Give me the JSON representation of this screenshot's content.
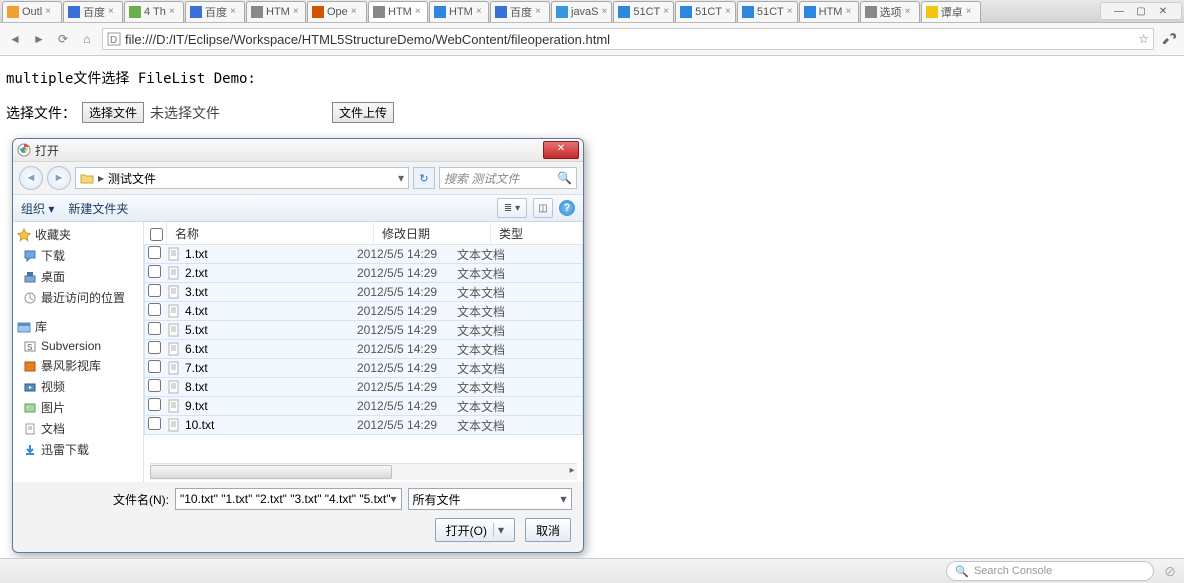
{
  "tabs": [
    {
      "label": "Outl"
    },
    {
      "label": "百度"
    },
    {
      "label": "4 Th"
    },
    {
      "label": "百度"
    },
    {
      "label": "HTM"
    },
    {
      "label": "Ope"
    },
    {
      "label": "HTM",
      "active": true
    },
    {
      "label": "HTM"
    },
    {
      "label": "百度"
    },
    {
      "label": "javaS"
    },
    {
      "label": "51CT"
    },
    {
      "label": "51CT"
    },
    {
      "label": "51CT"
    },
    {
      "label": "HTM"
    },
    {
      "label": "选项"
    },
    {
      "label": "谭卓"
    }
  ],
  "url": "file:///D:/IT/Eclipse/Workspace/HTML5StructureDemo/WebContent/fileoperation.html",
  "page": {
    "heading": "multiple文件选择 FileList Demo:",
    "label_select": "选择文件：",
    "btn_choose": "选择文件",
    "status_nofile": "未选择文件",
    "btn_upload": "文件上传"
  },
  "dialog": {
    "title": "打开",
    "crumb_folder": "测试文件",
    "search_placeholder": "搜索 测试文件",
    "toolbar_organize": "组织 ▾",
    "toolbar_newfolder": "新建文件夹",
    "cols": {
      "name": "名称",
      "date": "修改日期",
      "type": "类型"
    },
    "files": [
      {
        "name": "1.txt",
        "date": "2012/5/5 14:29",
        "type": "文本文档"
      },
      {
        "name": "2.txt",
        "date": "2012/5/5 14:29",
        "type": "文本文档"
      },
      {
        "name": "3.txt",
        "date": "2012/5/5 14:29",
        "type": "文本文档"
      },
      {
        "name": "4.txt",
        "date": "2012/5/5 14:29",
        "type": "文本文档"
      },
      {
        "name": "5.txt",
        "date": "2012/5/5 14:29",
        "type": "文本文档"
      },
      {
        "name": "6.txt",
        "date": "2012/5/5 14:29",
        "type": "文本文档"
      },
      {
        "name": "7.txt",
        "date": "2012/5/5 14:29",
        "type": "文本文档"
      },
      {
        "name": "8.txt",
        "date": "2012/5/5 14:29",
        "type": "文本文档"
      },
      {
        "name": "9.txt",
        "date": "2012/5/5 14:29",
        "type": "文本文档"
      },
      {
        "name": "10.txt",
        "date": "2012/5/5 14:29",
        "type": "文本文档"
      }
    ],
    "sidebar": {
      "fav_header": "收藏夹",
      "fav_items": [
        "下载",
        "桌面",
        "最近访问的位置"
      ],
      "lib_header": "库",
      "lib_items": [
        "Subversion",
        "暴风影视库",
        "视频",
        "图片",
        "文档",
        "迅雷下载"
      ]
    },
    "filename_label": "文件名(N):",
    "filename_value": "\"10.txt\" \"1.txt\" \"2.txt\" \"3.txt\" \"4.txt\" \"5.txt\"",
    "filter_value": "所有文件",
    "btn_open": "打开(O)",
    "btn_cancel": "取消"
  },
  "console": {
    "placeholder": "Search Console"
  }
}
